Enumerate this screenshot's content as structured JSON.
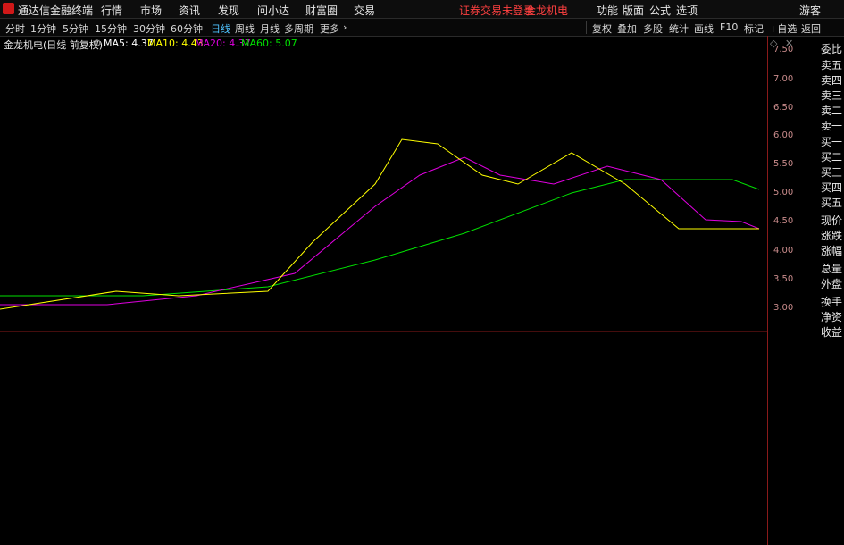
{
  "title_bar": {
    "app_name": "通达信金融终端",
    "menu": [
      "行情",
      "市场",
      "资讯",
      "发现",
      "问小达",
      "财富圈",
      "交易"
    ],
    "broker_status": "证券交易未登录",
    "stock": "金龙机电",
    "right_menu": [
      "功能",
      "版面",
      "公式",
      "选项"
    ],
    "user": "游客"
  },
  "toolbar": {
    "periods": [
      "分时",
      "1分钟",
      "5分钟",
      "15分钟",
      "30分钟",
      "60分钟",
      "日线",
      "周线",
      "月线",
      "多周期",
      "更多"
    ],
    "selected_period": "日线",
    "tools": [
      "复权",
      "叠加",
      "多股",
      "统计",
      "画线",
      "F10",
      "标记",
      "+自选",
      "返回"
    ]
  },
  "legend": {
    "stock_label": "金龙机电(日线 前复权)",
    "ma5": "MA5: 4.37",
    "ma10": "MA10: 4.43",
    "ma20": "MA20: 4.37",
    "ma60": "MA60: 5.07"
  },
  "price_axis": {
    "ticks": [
      "7.50",
      "7.00",
      "6.50",
      "6.00",
      "5.50",
      "5.00",
      "4.50",
      "4.00",
      "3.50",
      "3.00"
    ]
  },
  "side_panel": {
    "top_labels": [
      "委比",
      "卖五",
      "卖四",
      "卖三",
      "卖二",
      "卖一",
      "买一",
      "买二",
      "买三",
      "买四",
      "买五",
      "现价",
      "涨跌",
      "涨幅",
      "总量",
      "外盘",
      "换手",
      "净资",
      "收益"
    ]
  },
  "colors": {
    "up": "#ff2a2a",
    "down": "#00e5ff",
    "ma5": "#ffffff",
    "ma10": "#ffff00",
    "ma20": "#e000e0",
    "ma60": "#00e000"
  }
}
